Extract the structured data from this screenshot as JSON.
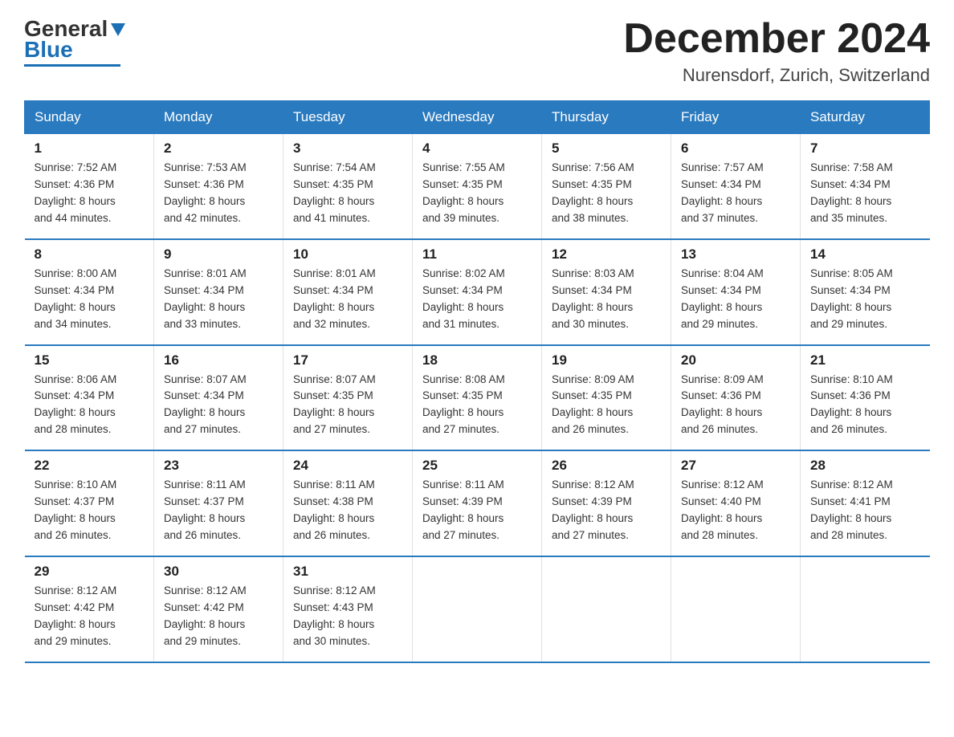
{
  "header": {
    "logo_general": "General",
    "logo_blue": "Blue",
    "month_title": "December 2024",
    "location": "Nurensdorf, Zurich, Switzerland"
  },
  "days_of_week": [
    "Sunday",
    "Monday",
    "Tuesday",
    "Wednesday",
    "Thursday",
    "Friday",
    "Saturday"
  ],
  "weeks": [
    [
      {
        "day": "1",
        "sunrise": "7:52 AM",
        "sunset": "4:36 PM",
        "daylight": "8 hours and 44 minutes."
      },
      {
        "day": "2",
        "sunrise": "7:53 AM",
        "sunset": "4:36 PM",
        "daylight": "8 hours and 42 minutes."
      },
      {
        "day": "3",
        "sunrise": "7:54 AM",
        "sunset": "4:35 PM",
        "daylight": "8 hours and 41 minutes."
      },
      {
        "day": "4",
        "sunrise": "7:55 AM",
        "sunset": "4:35 PM",
        "daylight": "8 hours and 39 minutes."
      },
      {
        "day": "5",
        "sunrise": "7:56 AM",
        "sunset": "4:35 PM",
        "daylight": "8 hours and 38 minutes."
      },
      {
        "day": "6",
        "sunrise": "7:57 AM",
        "sunset": "4:34 PM",
        "daylight": "8 hours and 37 minutes."
      },
      {
        "day": "7",
        "sunrise": "7:58 AM",
        "sunset": "4:34 PM",
        "daylight": "8 hours and 35 minutes."
      }
    ],
    [
      {
        "day": "8",
        "sunrise": "8:00 AM",
        "sunset": "4:34 PM",
        "daylight": "8 hours and 34 minutes."
      },
      {
        "day": "9",
        "sunrise": "8:01 AM",
        "sunset": "4:34 PM",
        "daylight": "8 hours and 33 minutes."
      },
      {
        "day": "10",
        "sunrise": "8:01 AM",
        "sunset": "4:34 PM",
        "daylight": "8 hours and 32 minutes."
      },
      {
        "day": "11",
        "sunrise": "8:02 AM",
        "sunset": "4:34 PM",
        "daylight": "8 hours and 31 minutes."
      },
      {
        "day": "12",
        "sunrise": "8:03 AM",
        "sunset": "4:34 PM",
        "daylight": "8 hours and 30 minutes."
      },
      {
        "day": "13",
        "sunrise": "8:04 AM",
        "sunset": "4:34 PM",
        "daylight": "8 hours and 29 minutes."
      },
      {
        "day": "14",
        "sunrise": "8:05 AM",
        "sunset": "4:34 PM",
        "daylight": "8 hours and 29 minutes."
      }
    ],
    [
      {
        "day": "15",
        "sunrise": "8:06 AM",
        "sunset": "4:34 PM",
        "daylight": "8 hours and 28 minutes."
      },
      {
        "day": "16",
        "sunrise": "8:07 AM",
        "sunset": "4:34 PM",
        "daylight": "8 hours and 27 minutes."
      },
      {
        "day": "17",
        "sunrise": "8:07 AM",
        "sunset": "4:35 PM",
        "daylight": "8 hours and 27 minutes."
      },
      {
        "day": "18",
        "sunrise": "8:08 AM",
        "sunset": "4:35 PM",
        "daylight": "8 hours and 27 minutes."
      },
      {
        "day": "19",
        "sunrise": "8:09 AM",
        "sunset": "4:35 PM",
        "daylight": "8 hours and 26 minutes."
      },
      {
        "day": "20",
        "sunrise": "8:09 AM",
        "sunset": "4:36 PM",
        "daylight": "8 hours and 26 minutes."
      },
      {
        "day": "21",
        "sunrise": "8:10 AM",
        "sunset": "4:36 PM",
        "daylight": "8 hours and 26 minutes."
      }
    ],
    [
      {
        "day": "22",
        "sunrise": "8:10 AM",
        "sunset": "4:37 PM",
        "daylight": "8 hours and 26 minutes."
      },
      {
        "day": "23",
        "sunrise": "8:11 AM",
        "sunset": "4:37 PM",
        "daylight": "8 hours and 26 minutes."
      },
      {
        "day": "24",
        "sunrise": "8:11 AM",
        "sunset": "4:38 PM",
        "daylight": "8 hours and 26 minutes."
      },
      {
        "day": "25",
        "sunrise": "8:11 AM",
        "sunset": "4:39 PM",
        "daylight": "8 hours and 27 minutes."
      },
      {
        "day": "26",
        "sunrise": "8:12 AM",
        "sunset": "4:39 PM",
        "daylight": "8 hours and 27 minutes."
      },
      {
        "day": "27",
        "sunrise": "8:12 AM",
        "sunset": "4:40 PM",
        "daylight": "8 hours and 28 minutes."
      },
      {
        "day": "28",
        "sunrise": "8:12 AM",
        "sunset": "4:41 PM",
        "daylight": "8 hours and 28 minutes."
      }
    ],
    [
      {
        "day": "29",
        "sunrise": "8:12 AM",
        "sunset": "4:42 PM",
        "daylight": "8 hours and 29 minutes."
      },
      {
        "day": "30",
        "sunrise": "8:12 AM",
        "sunset": "4:42 PM",
        "daylight": "8 hours and 29 minutes."
      },
      {
        "day": "31",
        "sunrise": "8:12 AM",
        "sunset": "4:43 PM",
        "daylight": "8 hours and 30 minutes."
      },
      null,
      null,
      null,
      null
    ]
  ],
  "labels": {
    "sunrise_prefix": "Sunrise: ",
    "sunset_prefix": "Sunset: ",
    "daylight_prefix": "Daylight: "
  }
}
